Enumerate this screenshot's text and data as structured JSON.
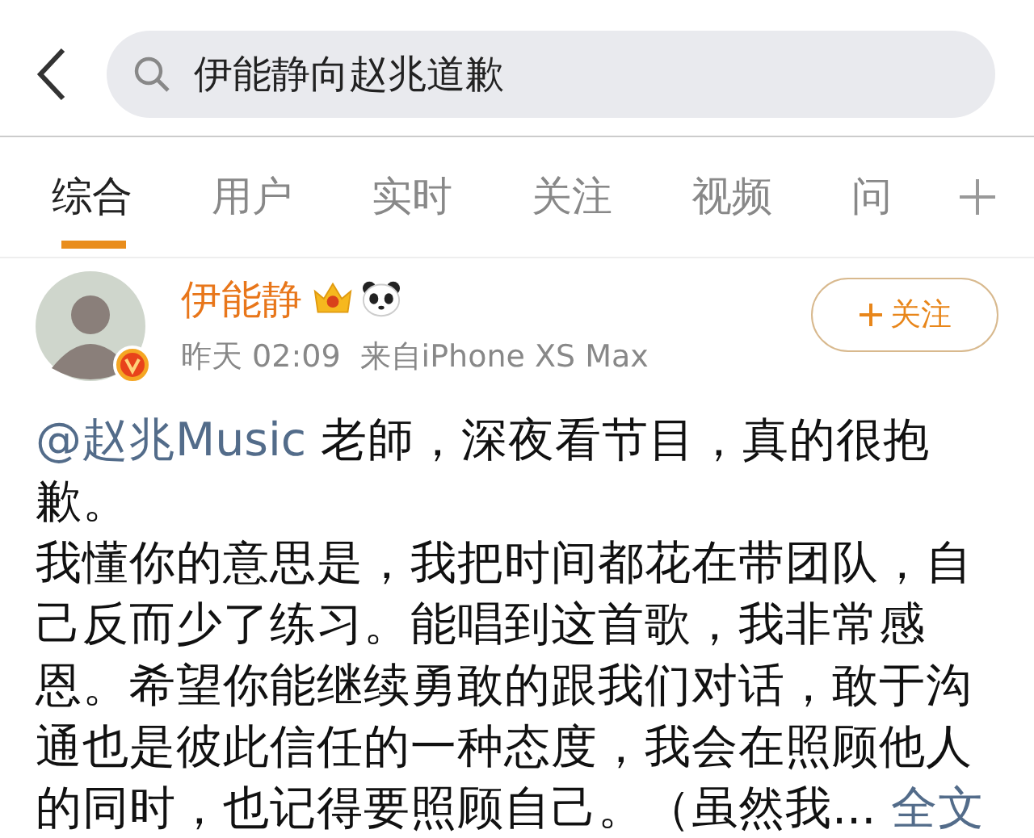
{
  "search": {
    "value": "伊能静向赵兆道歉"
  },
  "tabs": [
    {
      "label": "综合",
      "selected": true
    },
    {
      "label": "用户",
      "selected": false
    },
    {
      "label": "实时",
      "selected": false
    },
    {
      "label": "关注",
      "selected": false
    },
    {
      "label": "视频",
      "selected": false
    },
    {
      "label": "问",
      "selected": false
    }
  ],
  "post": {
    "author": "伊能静",
    "time": "昨天 02:09",
    "source": "来自iPhone XS Max",
    "follow_button": "关注",
    "paragraphs": [
      {
        "mention": "@赵兆Music",
        "text": " 老師，深夜看节目，真的很抱歉。"
      },
      {
        "text": "我懂你的意思是，我把时间都花在带团队，自己反而少了练习。能唱到这首歌，我非常感恩。希望你能继续勇敢的跟我们对话，敢于沟通也是彼此信任的一种态度，我会在照顾他人的同时，也记得要照顾自己。（虽然我...",
        "more": "全文"
      }
    ]
  }
}
